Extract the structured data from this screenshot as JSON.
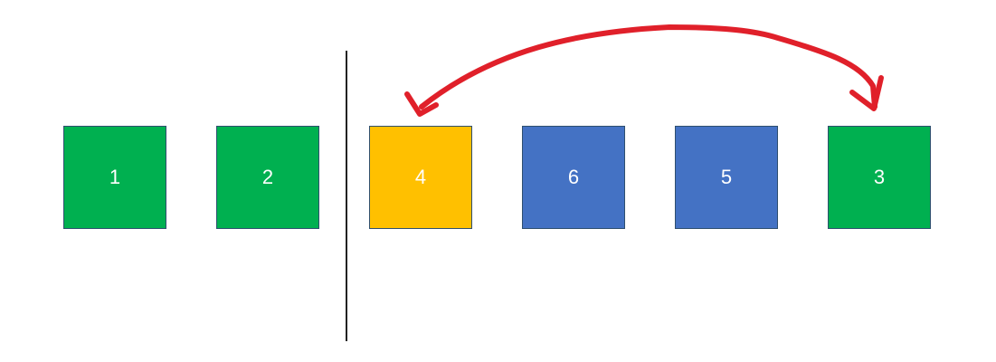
{
  "boxes": [
    {
      "label": "1",
      "color": "#00b050"
    },
    {
      "label": "2",
      "color": "#00b050"
    },
    {
      "label": "4",
      "color": "#ffc000"
    },
    {
      "label": "6",
      "color": "#4472c4"
    },
    {
      "label": "5",
      "color": "#4472c4"
    },
    {
      "label": "3",
      "color": "#00b050"
    }
  ],
  "divider": {
    "color": "#222222"
  },
  "swap_arrow": {
    "color": "#e0202a",
    "from_box": "3",
    "to_box": "4",
    "double_headed": true
  }
}
